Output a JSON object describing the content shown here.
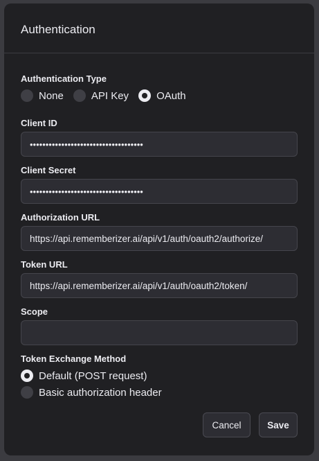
{
  "dialog": {
    "title": "Authentication"
  },
  "auth_type": {
    "label": "Authentication Type",
    "options": [
      {
        "label": "None",
        "selected": false
      },
      {
        "label": "API Key",
        "selected": false
      },
      {
        "label": "OAuth",
        "selected": true
      }
    ]
  },
  "client_id": {
    "label": "Client ID",
    "value": "••••••••••••••••••••••••••••••••••••"
  },
  "client_secret": {
    "label": "Client Secret",
    "value": "••••••••••••••••••••••••••••••••••••"
  },
  "authorization_url": {
    "label": "Authorization URL",
    "value": "https://api.rememberizer.ai/api/v1/auth/oauth2/authorize/"
  },
  "token_url": {
    "label": "Token URL",
    "value": "https://api.rememberizer.ai/api/v1/auth/oauth2/token/"
  },
  "scope": {
    "label": "Scope",
    "value": ""
  },
  "token_exchange": {
    "label": "Token Exchange Method",
    "options": [
      {
        "label": "Default (POST request)",
        "selected": true
      },
      {
        "label": "Basic authorization header",
        "selected": false
      }
    ]
  },
  "buttons": {
    "cancel": "Cancel",
    "save": "Save"
  },
  "colors": {
    "dialog_bg": "#202023",
    "input_bg": "#2d2d33",
    "text": "#ececf1"
  }
}
